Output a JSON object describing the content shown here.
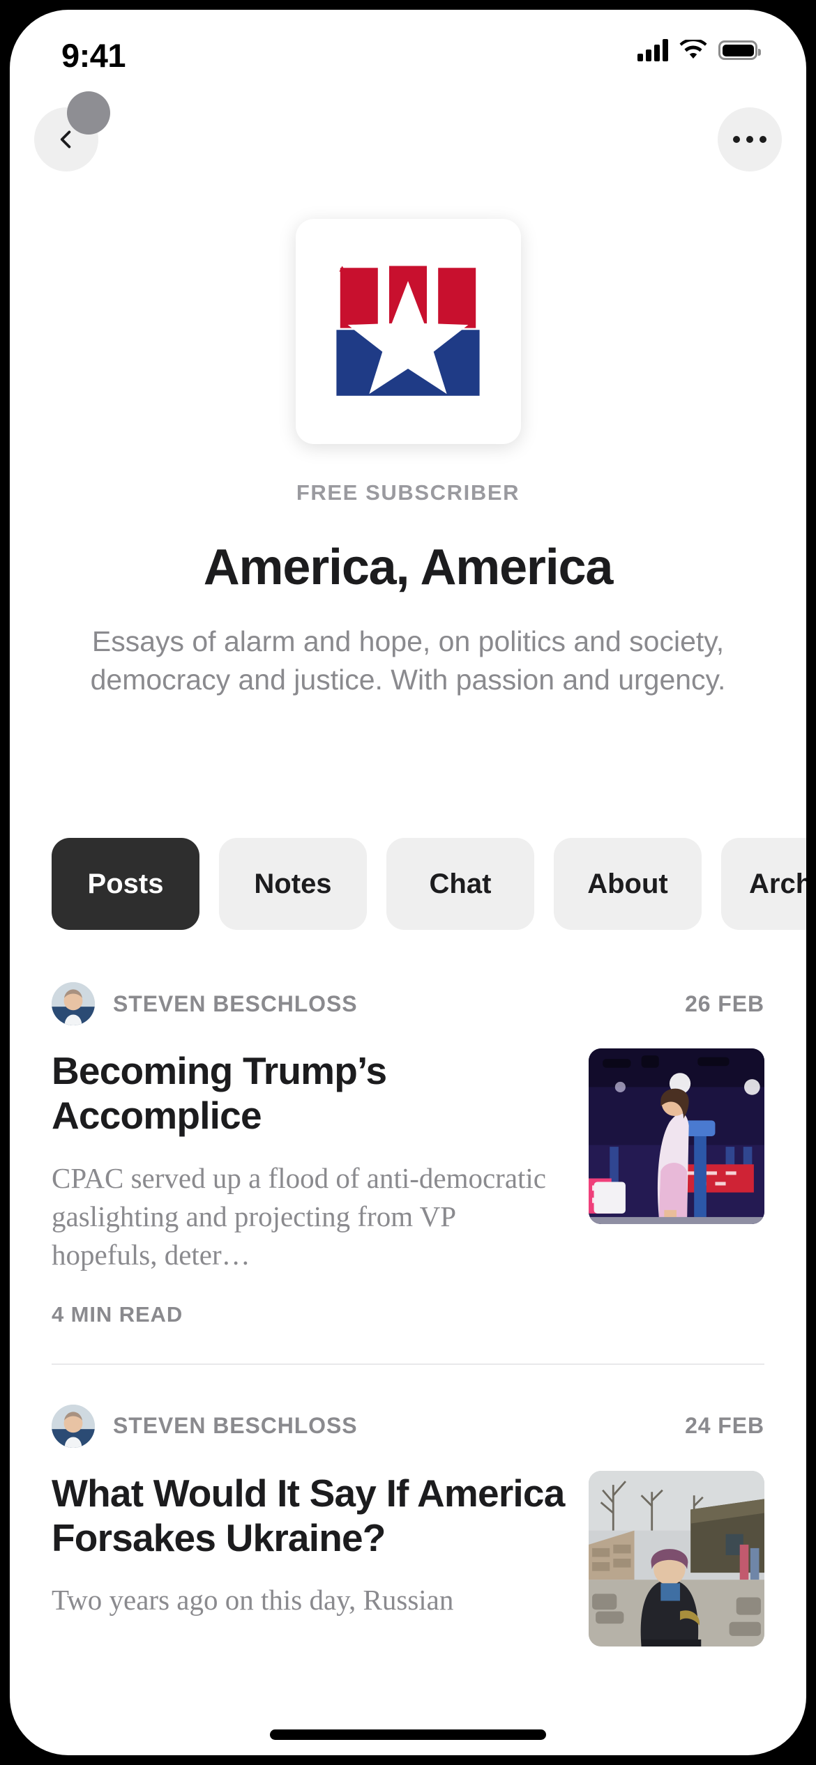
{
  "status_bar": {
    "time": "9:41",
    "signal_icon": "cellular-signal-icon",
    "wifi_icon": "wifi-icon",
    "battery_icon": "battery-full-icon"
  },
  "nav": {
    "back_icon": "chevron-left-icon",
    "more_icon": "ellipsis-icon"
  },
  "publication": {
    "logo_icon": "america-america-flag-logo",
    "subscriber_status": "FREE SUBSCRIBER",
    "title": "America, America",
    "description": "Essays of alarm and hope, on politics and society, democracy and justice. With passion and urgency."
  },
  "tabs": [
    {
      "label": "Posts",
      "active": true
    },
    {
      "label": "Notes",
      "active": false
    },
    {
      "label": "Chat",
      "active": false
    },
    {
      "label": "About",
      "active": false
    },
    {
      "label": "Archive",
      "active": false
    }
  ],
  "posts": [
    {
      "author": "STEVEN BESCHLOSS",
      "date": "26 FEB",
      "title": "Becoming Trump’s Accomplice",
      "excerpt": "CPAC served up a flood of anti-democratic gaslighting and projecting from VP hopefuls, deter…",
      "read_time": "4 MIN READ",
      "thumbnail_icon": "cpac-stage-speaker-photo"
    },
    {
      "author": "STEVEN BESCHLOSS",
      "date": "24 FEB",
      "title": "What Would It Say If America Forsakes Ukraine?",
      "excerpt": "Two years ago on this day, Russian",
      "read_time": "",
      "thumbnail_icon": "ukraine-village-woman-photo"
    }
  ],
  "colors": {
    "accent_dark": "#2E2E2E",
    "tab_inactive_bg": "#EFEFEF",
    "muted_text": "#8A8A8E",
    "logo_red": "#C8102E",
    "logo_blue": "#1F3B86"
  }
}
